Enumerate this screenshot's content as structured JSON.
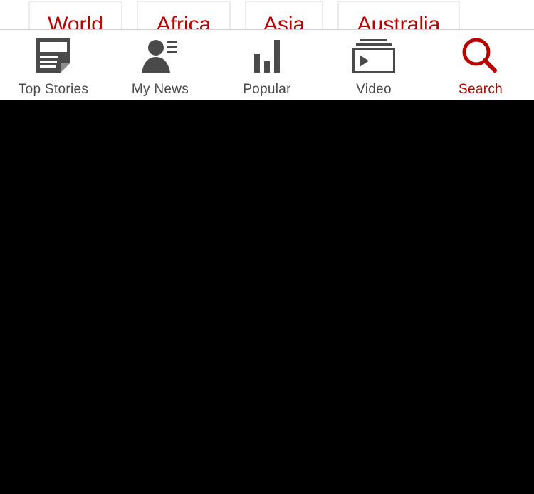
{
  "region_nav": {
    "items": [
      {
        "label": "World"
      },
      {
        "label": "Africa"
      },
      {
        "label": "Asia"
      },
      {
        "label": "Australia"
      }
    ]
  },
  "tab_bar": {
    "tabs": [
      {
        "label": "Top Stories",
        "icon": "newspaper-icon",
        "active": false
      },
      {
        "label": "My News",
        "icon": "person-news-icon",
        "active": false
      },
      {
        "label": "Popular",
        "icon": "bar-chart-icon",
        "active": false
      },
      {
        "label": "Video",
        "icon": "video-play-icon",
        "active": false
      },
      {
        "label": "Search",
        "icon": "search-icon",
        "active": true
      }
    ]
  },
  "colors": {
    "accent": "#b80000",
    "icon_gray": "#4a4a4a",
    "content_background": "#000000"
  }
}
